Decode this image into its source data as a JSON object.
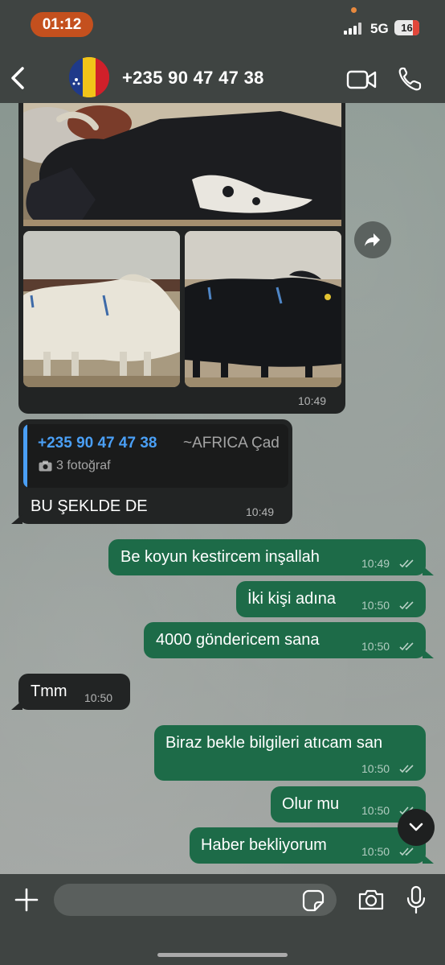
{
  "status_bar": {
    "time": "01:12",
    "network": "5G",
    "battery": "16"
  },
  "header": {
    "contact": "+235 90 47 47 38"
  },
  "media_message": {
    "time": "10:49"
  },
  "reply_message": {
    "quoted_sender": "+235 90 47 47 38",
    "quoted_group": "~AFRICA Çad",
    "quoted_text": "3 fotoğraf",
    "text": "BU ŞEKLDE DE",
    "time": "10:49"
  },
  "messages": [
    {
      "dir": "out",
      "text": "Be koyun kestircem inşallah",
      "time": "10:49"
    },
    {
      "dir": "out",
      "text": "İki kişi adına",
      "time": "10:50"
    },
    {
      "dir": "out",
      "text": "4000 göndericem sana",
      "time": "10:50"
    },
    {
      "dir": "in",
      "text": "Tmm",
      "time": "10:50"
    },
    {
      "dir": "out",
      "text": "Biraz bekle bilgileri atıcam san",
      "time": "10:50"
    },
    {
      "dir": "out",
      "text": "Olur mu",
      "time": "10:50"
    },
    {
      "dir": "out",
      "text": "Haber bekliyorum",
      "time": "10:50"
    }
  ],
  "input": {
    "placeholder": ""
  },
  "icons": [
    "back-icon",
    "avatar",
    "video-call-icon",
    "phone-call-icon",
    "forward-icon",
    "scroll-down-icon",
    "plus-icon",
    "sticker-icon",
    "camera-icon",
    "mic-icon",
    "read-ticks-icon",
    "camera-small-icon"
  ],
  "colors": {
    "bar": "#3f4442",
    "incoming_bubble": "#222424",
    "outgoing_bubble": "#1d6b48",
    "quote_accent": "#4a9ff5",
    "time_pill": "#c4501e"
  }
}
